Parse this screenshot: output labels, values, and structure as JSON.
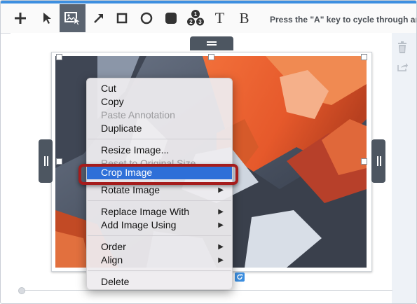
{
  "toolbar": {
    "tools": [
      {
        "name": "add",
        "icon": "plus-icon"
      },
      {
        "name": "select",
        "icon": "arrow-pointer-icon"
      },
      {
        "name": "image",
        "icon": "image-cursor-icon",
        "active": true
      },
      {
        "name": "arrow",
        "icon": "diagonal-arrow-icon"
      },
      {
        "name": "rectangle",
        "icon": "square-icon"
      },
      {
        "name": "ellipse",
        "icon": "circle-icon"
      },
      {
        "name": "rounded-rect",
        "icon": "filled-rounded-square-icon"
      },
      {
        "name": "numbered-steps",
        "icon": "numbered-circles-icon"
      },
      {
        "name": "text",
        "label": "T"
      },
      {
        "name": "bold-text",
        "label": "B"
      }
    ],
    "hint": "Press the \"A\" key to cycle through anno"
  },
  "step_numbers": [
    "1",
    "2",
    "3"
  ],
  "context_menu": {
    "items": [
      {
        "label": "Cut",
        "enabled": true
      },
      {
        "label": "Copy",
        "enabled": true
      },
      {
        "label": "Paste Annotation",
        "enabled": false
      },
      {
        "label": "Duplicate",
        "enabled": true
      },
      {
        "label": "Resize Image...",
        "enabled": true
      },
      {
        "label": "Reset to Original Size",
        "enabled": false
      },
      {
        "label": "Crop Image",
        "enabled": true,
        "highlighted": true
      },
      {
        "label": "Rotate Image",
        "enabled": true,
        "submenu": true
      },
      {
        "label": "Replace Image With",
        "enabled": true,
        "submenu": true
      },
      {
        "label": "Add Image Using",
        "enabled": true,
        "submenu": true
      },
      {
        "label": "Order",
        "enabled": true,
        "submenu": true
      },
      {
        "label": "Align",
        "enabled": true,
        "submenu": true
      },
      {
        "label": "Delete",
        "enabled": true
      }
    ],
    "submenu_arrow": "▶"
  },
  "colors": {
    "accent": "#3d8fe0",
    "highlight": "#2e6fd8",
    "callout": "#a51c1c",
    "handle_dark": "#4d5661",
    "active_tool": "#5b6470"
  }
}
